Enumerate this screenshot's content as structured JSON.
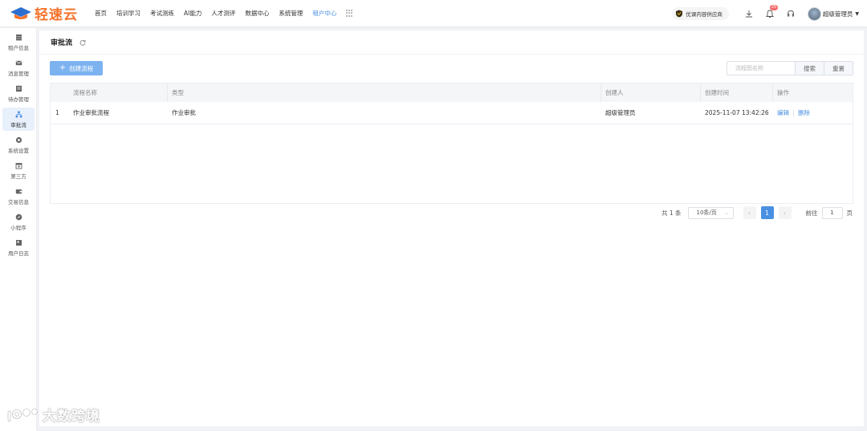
{
  "brand": {
    "name": "轻速云",
    "color": "#f5722a"
  },
  "top_nav": {
    "items": [
      "首页",
      "培训学习",
      "考试测练",
      "AI能力",
      "人才测评",
      "数据中心",
      "系统管理",
      "租户中心"
    ],
    "active_index": 7
  },
  "top_right": {
    "promo": "优课内容供应商",
    "notification_count": "25",
    "user_name": "超级管理员"
  },
  "sidebar": {
    "items": [
      {
        "label": "租户信息",
        "icon": "database-icon"
      },
      {
        "label": "消息管理",
        "icon": "mail-icon"
      },
      {
        "label": "待办管理",
        "icon": "todo-icon"
      },
      {
        "label": "审批流",
        "icon": "flow-icon"
      },
      {
        "label": "系统设置",
        "icon": "settings-icon"
      },
      {
        "label": "第三方",
        "icon": "calendar-icon"
      },
      {
        "label": "交易信息",
        "icon": "wallet-icon"
      },
      {
        "label": "小程序",
        "icon": "compass-icon"
      },
      {
        "label": "用户日志",
        "icon": "log-icon"
      }
    ],
    "active_index": 3
  },
  "page": {
    "title": "审批流",
    "create_button": "创建流程",
    "search": {
      "placeholder": "流程图名称",
      "value": "",
      "search_label": "搜索",
      "reset_label": "重置"
    }
  },
  "table": {
    "headers": [
      "",
      "流程名称",
      "类型",
      "创建人",
      "创建时间",
      "操作"
    ],
    "rows": [
      {
        "index": "1",
        "name": "作业审批流程",
        "type": "作业审批",
        "creator": "超级管理员",
        "created_at": "2025-11-07 13:42:26",
        "edit": "编辑",
        "delete": "删除"
      }
    ]
  },
  "pagination": {
    "total_text": "共 1 条",
    "page_size": "10条/页",
    "current_page": "1",
    "goto_prefix": "前往",
    "goto_value": "1",
    "goto_suffix": "页"
  },
  "watermark": {
    "text": "大数跨境"
  },
  "colors": {
    "accent": "#4a90e2",
    "create_button": "#7cb2f0",
    "badge": "#f56c6c"
  }
}
